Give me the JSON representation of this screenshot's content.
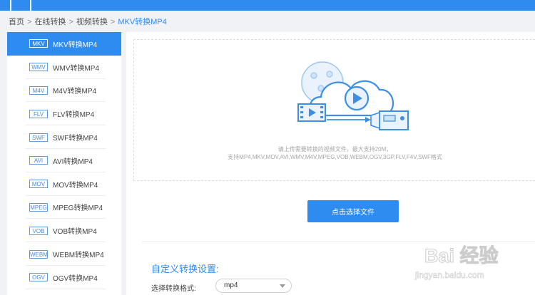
{
  "breadcrumb": {
    "home": "首页",
    "separator": ">",
    "level1": "在线转换",
    "level2": "视频转换",
    "current": "MKV转换MP4"
  },
  "sidebar": {
    "items": [
      {
        "tag": "MKV",
        "label": "MKV转换MP4",
        "active": true
      },
      {
        "tag": "WMV",
        "label": "WMV转换MP4",
        "active": false
      },
      {
        "tag": "M4V",
        "label": "M4V转换MP4",
        "active": false
      },
      {
        "tag": "FLV",
        "label": "FLV转换MP4",
        "active": false
      },
      {
        "tag": "SWF",
        "label": "SWF转换MP4",
        "active": false
      },
      {
        "tag": "AVI",
        "label": "AVI转换MP4",
        "active": false
      },
      {
        "tag": "MOV",
        "label": "MOV转换MP4",
        "active": false
      },
      {
        "tag": "MPEG",
        "label": "MPEG转换MP4",
        "active": false
      },
      {
        "tag": "VOB",
        "label": "VOB转换MP4",
        "active": false
      },
      {
        "tag": "WEBM",
        "label": "WEBM转换MP4",
        "active": false
      },
      {
        "tag": "OGV",
        "label": "OGV转换MP4",
        "active": false
      }
    ]
  },
  "upload": {
    "hint_line1": "请上传需要转换的视频文件，最大支持20M，",
    "hint_line2": "支持MP4,MKV,MOV,AVI,WMV,M4V,MPEG,VOB,WEBM,OGV,3GP,FLV,F4V,SWF格式",
    "button_label": "点击选择文件"
  },
  "settings": {
    "title": "自定义转换设置:",
    "format_label": "选择转换格式:",
    "format_value": "mp4"
  },
  "watermark": {
    "text": "Bai 经验",
    "url": "jingyan.baidu.com"
  },
  "colors": {
    "accent": "#2e8bf0",
    "background": "#f1f2f6",
    "hint_text": "#a5a5a5"
  },
  "icons": {
    "illustration": "cloud-video-upload-icon",
    "select_caret": "chevron-down-icon"
  }
}
